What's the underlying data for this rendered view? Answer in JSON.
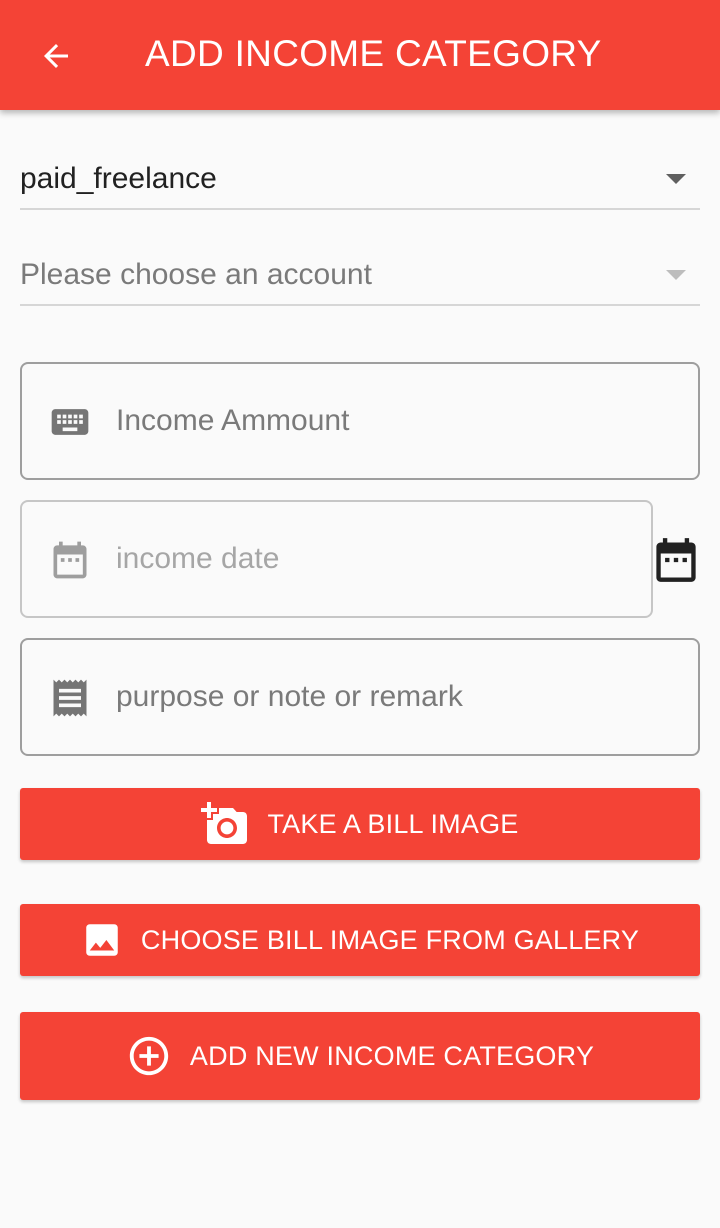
{
  "appbar": {
    "title": "ADD INCOME CATEGORY",
    "back_icon": "arrow-back-icon",
    "background": "#f44336"
  },
  "form": {
    "category_select": {
      "value": "paid_freelance"
    },
    "account_select": {
      "placeholder": "Please choose an account"
    },
    "amount_field": {
      "placeholder": "Income Ammount",
      "icon": "keyboard-icon"
    },
    "date_field": {
      "placeholder": "income date",
      "icon": "calendar-icon",
      "picker_icon": "calendar-icon"
    },
    "note_field": {
      "placeholder": "purpose or note or remark",
      "icon": "receipt-icon"
    }
  },
  "actions": {
    "take_photo_label": "TAKE A BILL IMAGE",
    "take_photo_icon": "add-a-photo-icon",
    "gallery_label": "CHOOSE BILL IMAGE FROM GALLERY",
    "gallery_icon": "image-icon",
    "submit_label": "ADD NEW INCOME CATEGORY",
    "submit_icon": "add-circle-outline-icon"
  }
}
